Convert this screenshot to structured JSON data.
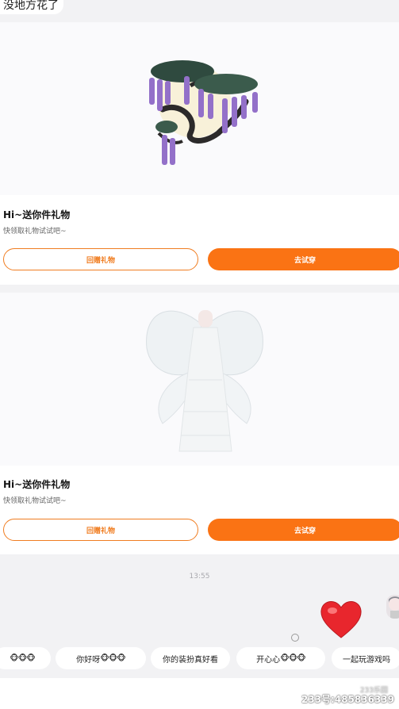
{
  "top_message": "没地方花了",
  "gift_cards": [
    {
      "title": "Hi~送你件礼物",
      "subtitle": "快领取礼物试试吧~",
      "return_gift_label": "回赠礼物",
      "try_on_label": "去试穿"
    },
    {
      "title": "Hi~送你件礼物",
      "subtitle": "快领取礼物试试吧~",
      "return_gift_label": "回赠礼物",
      "try_on_label": "去试穿"
    }
  ],
  "timestamp": "13:55",
  "quick_replies": [
    {
      "text": "",
      "faces": "🐵🐵🐵"
    },
    {
      "text": "你好呀",
      "faces": "🐵🐵🐵"
    },
    {
      "text": "你的装扮真好看",
      "faces": ""
    },
    {
      "text": "开心心",
      "faces": "🐵🐵🐵"
    },
    {
      "text": "一起玩游戏吗",
      "faces": ""
    }
  ],
  "watermark": {
    "text": "233号:485836339",
    "logo": "233乐园"
  },
  "colors": {
    "accent": "#fa7314",
    "outline": "#f07d21"
  }
}
